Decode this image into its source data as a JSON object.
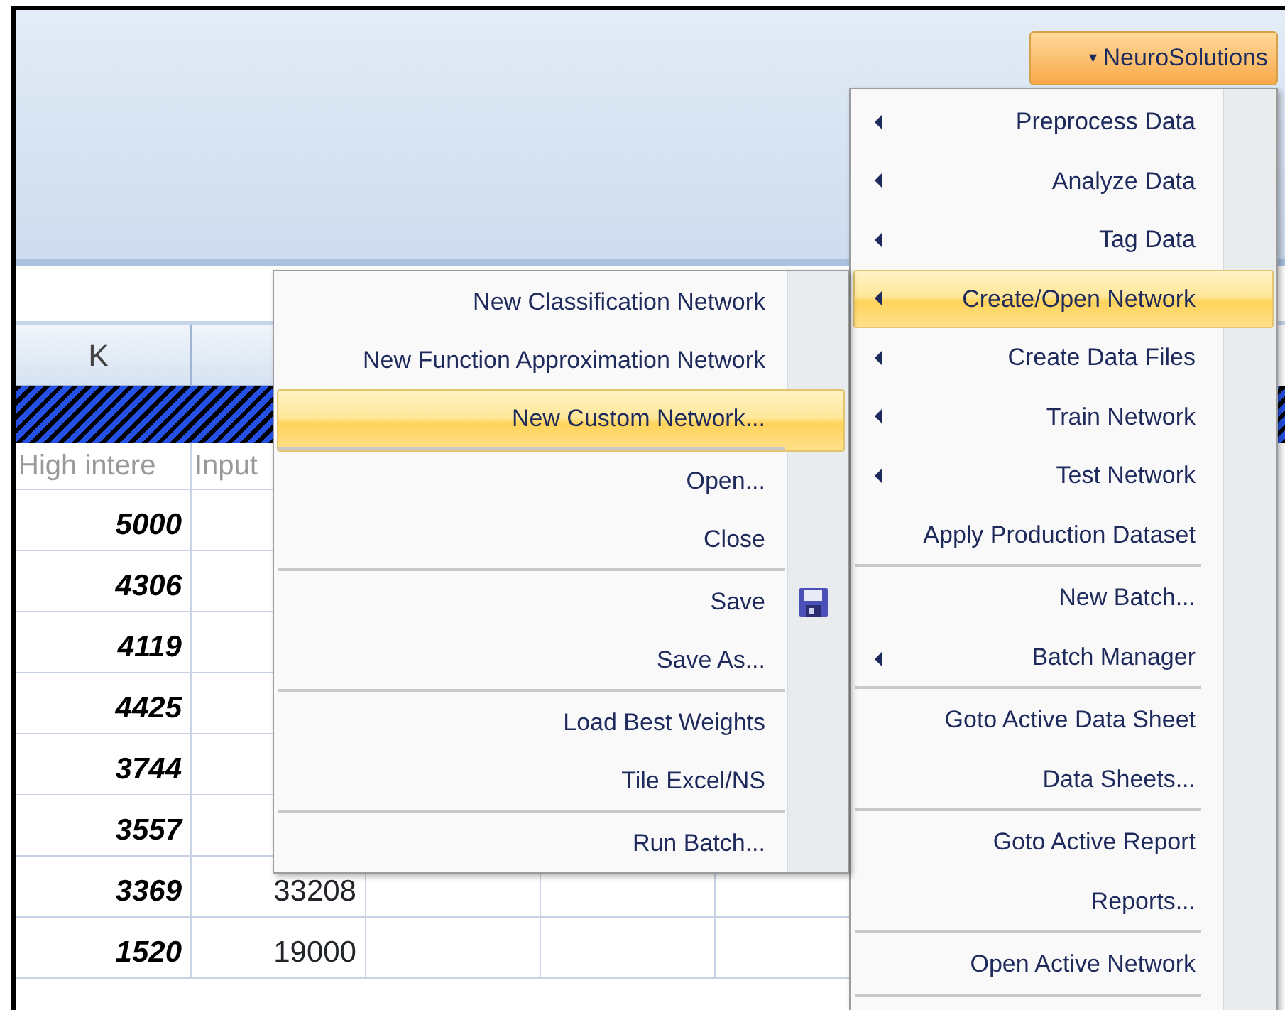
{
  "ribbon": {
    "button": {
      "label": "NeuroSolutions",
      "caret": "▾"
    }
  },
  "sheet": {
    "columns": [
      "K",
      "",
      "",
      "",
      ""
    ],
    "header_row": [
      "High intere",
      "Input"
    ],
    "rows": [
      {
        "cells": [
          "5000",
          ""
        ]
      },
      {
        "cells": [
          "4306",
          ""
        ]
      },
      {
        "cells": [
          "4119",
          ""
        ]
      },
      {
        "cells": [
          "4425",
          ""
        ]
      },
      {
        "cells": [
          "3744",
          ""
        ]
      },
      {
        "cells": [
          "3557",
          ""
        ]
      },
      {
        "cells": [
          "3369",
          "33208"
        ]
      },
      {
        "cells": [
          "1520",
          "19000"
        ]
      }
    ]
  },
  "main_menu": {
    "items": [
      {
        "label": "Preprocess Data",
        "submenu": true,
        "selected": false,
        "separator_after": false
      },
      {
        "label": "Analyze Data",
        "submenu": true,
        "selected": false,
        "separator_after": false
      },
      {
        "label": "Tag Data",
        "submenu": true,
        "selected": false,
        "separator_after": false
      },
      {
        "label": "Create/Open Network",
        "submenu": true,
        "selected": true,
        "separator_after": false
      },
      {
        "label": "Create Data Files",
        "submenu": true,
        "selected": false,
        "separator_after": false
      },
      {
        "label": "Train Network",
        "submenu": true,
        "selected": false,
        "separator_after": false
      },
      {
        "label": "Test Network",
        "submenu": true,
        "selected": false,
        "separator_after": false
      },
      {
        "label": "Apply Production Dataset",
        "submenu": false,
        "selected": false,
        "separator_after": true
      },
      {
        "label": "New Batch...",
        "submenu": false,
        "selected": false,
        "separator_after": false
      },
      {
        "label": "Batch Manager",
        "submenu": true,
        "selected": false,
        "separator_after": true
      },
      {
        "label": "Goto Active Data Sheet",
        "submenu": false,
        "selected": false,
        "separator_after": false
      },
      {
        "label": "Data Sheets...",
        "submenu": false,
        "selected": false,
        "separator_after": true
      },
      {
        "label": "Goto Active Report",
        "submenu": false,
        "selected": false,
        "separator_after": false
      },
      {
        "label": "Reports...",
        "submenu": false,
        "selected": false,
        "separator_after": true
      },
      {
        "label": "Open Active Network",
        "submenu": false,
        "selected": false,
        "separator_after": true
      }
    ]
  },
  "submenu": {
    "items": [
      {
        "label": "New Classification Network",
        "selected": false,
        "has_icon": false,
        "separator_after": false
      },
      {
        "label": "New Function Approximation Network",
        "selected": false,
        "has_icon": false,
        "separator_after": false
      },
      {
        "label": "New Custom Network...",
        "selected": true,
        "has_icon": false,
        "separator_after": true
      },
      {
        "label": "Open...",
        "selected": false,
        "has_icon": false,
        "separator_after": false
      },
      {
        "label": "Close",
        "selected": false,
        "has_icon": false,
        "separator_after": true
      },
      {
        "label": "Save",
        "selected": false,
        "has_icon": true,
        "separator_after": false
      },
      {
        "label": "Save As...",
        "selected": false,
        "has_icon": false,
        "separator_after": true
      },
      {
        "label": "Load Best Weights",
        "selected": false,
        "has_icon": false,
        "separator_after": false
      },
      {
        "label": "Tile Excel/NS",
        "selected": false,
        "has_icon": false,
        "separator_after": true
      },
      {
        "label": "Run Batch...",
        "selected": false,
        "has_icon": false,
        "separator_after": false
      }
    ]
  }
}
